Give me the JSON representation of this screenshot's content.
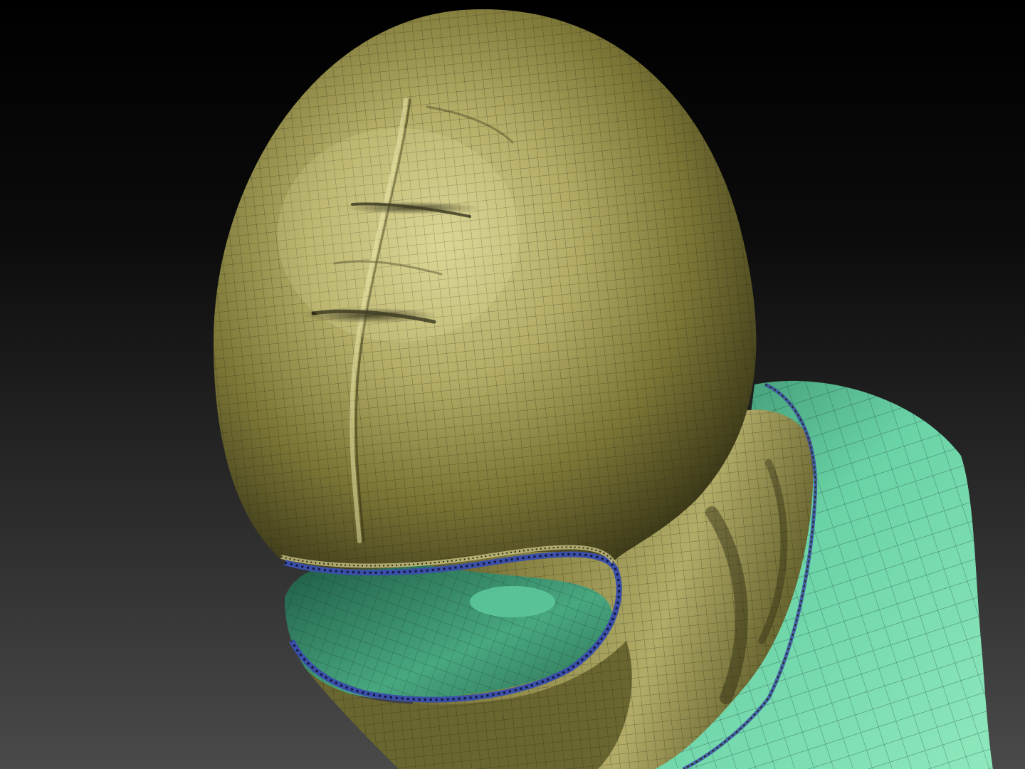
{
  "scene": {
    "subject": "sculpt-mesh",
    "colors": {
      "background_top": "#000000",
      "background_bottom": "#4a4a4a",
      "hood_light": "#d6d08f",
      "hood_mid": "#a09a55",
      "hood_dark": "#2e2c14",
      "body_light": "#8fe6bc",
      "body_mid": "#4fb88c",
      "body_dark": "#1f5a44",
      "seam_blue": "#3a4fa8",
      "wireframe": "#1e1e10"
    }
  }
}
